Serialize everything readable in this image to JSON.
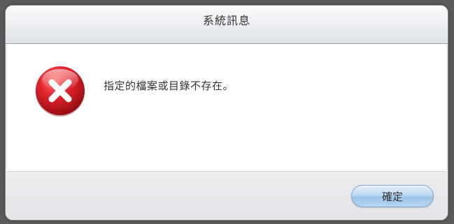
{
  "dialog": {
    "title": "系統訊息",
    "message": "指定的檔案或目錄不存在。",
    "icon": "error-icon",
    "ok_label": "確定"
  },
  "colors": {
    "error_red": "#d11a22",
    "button_blue": "#a9cdee"
  }
}
